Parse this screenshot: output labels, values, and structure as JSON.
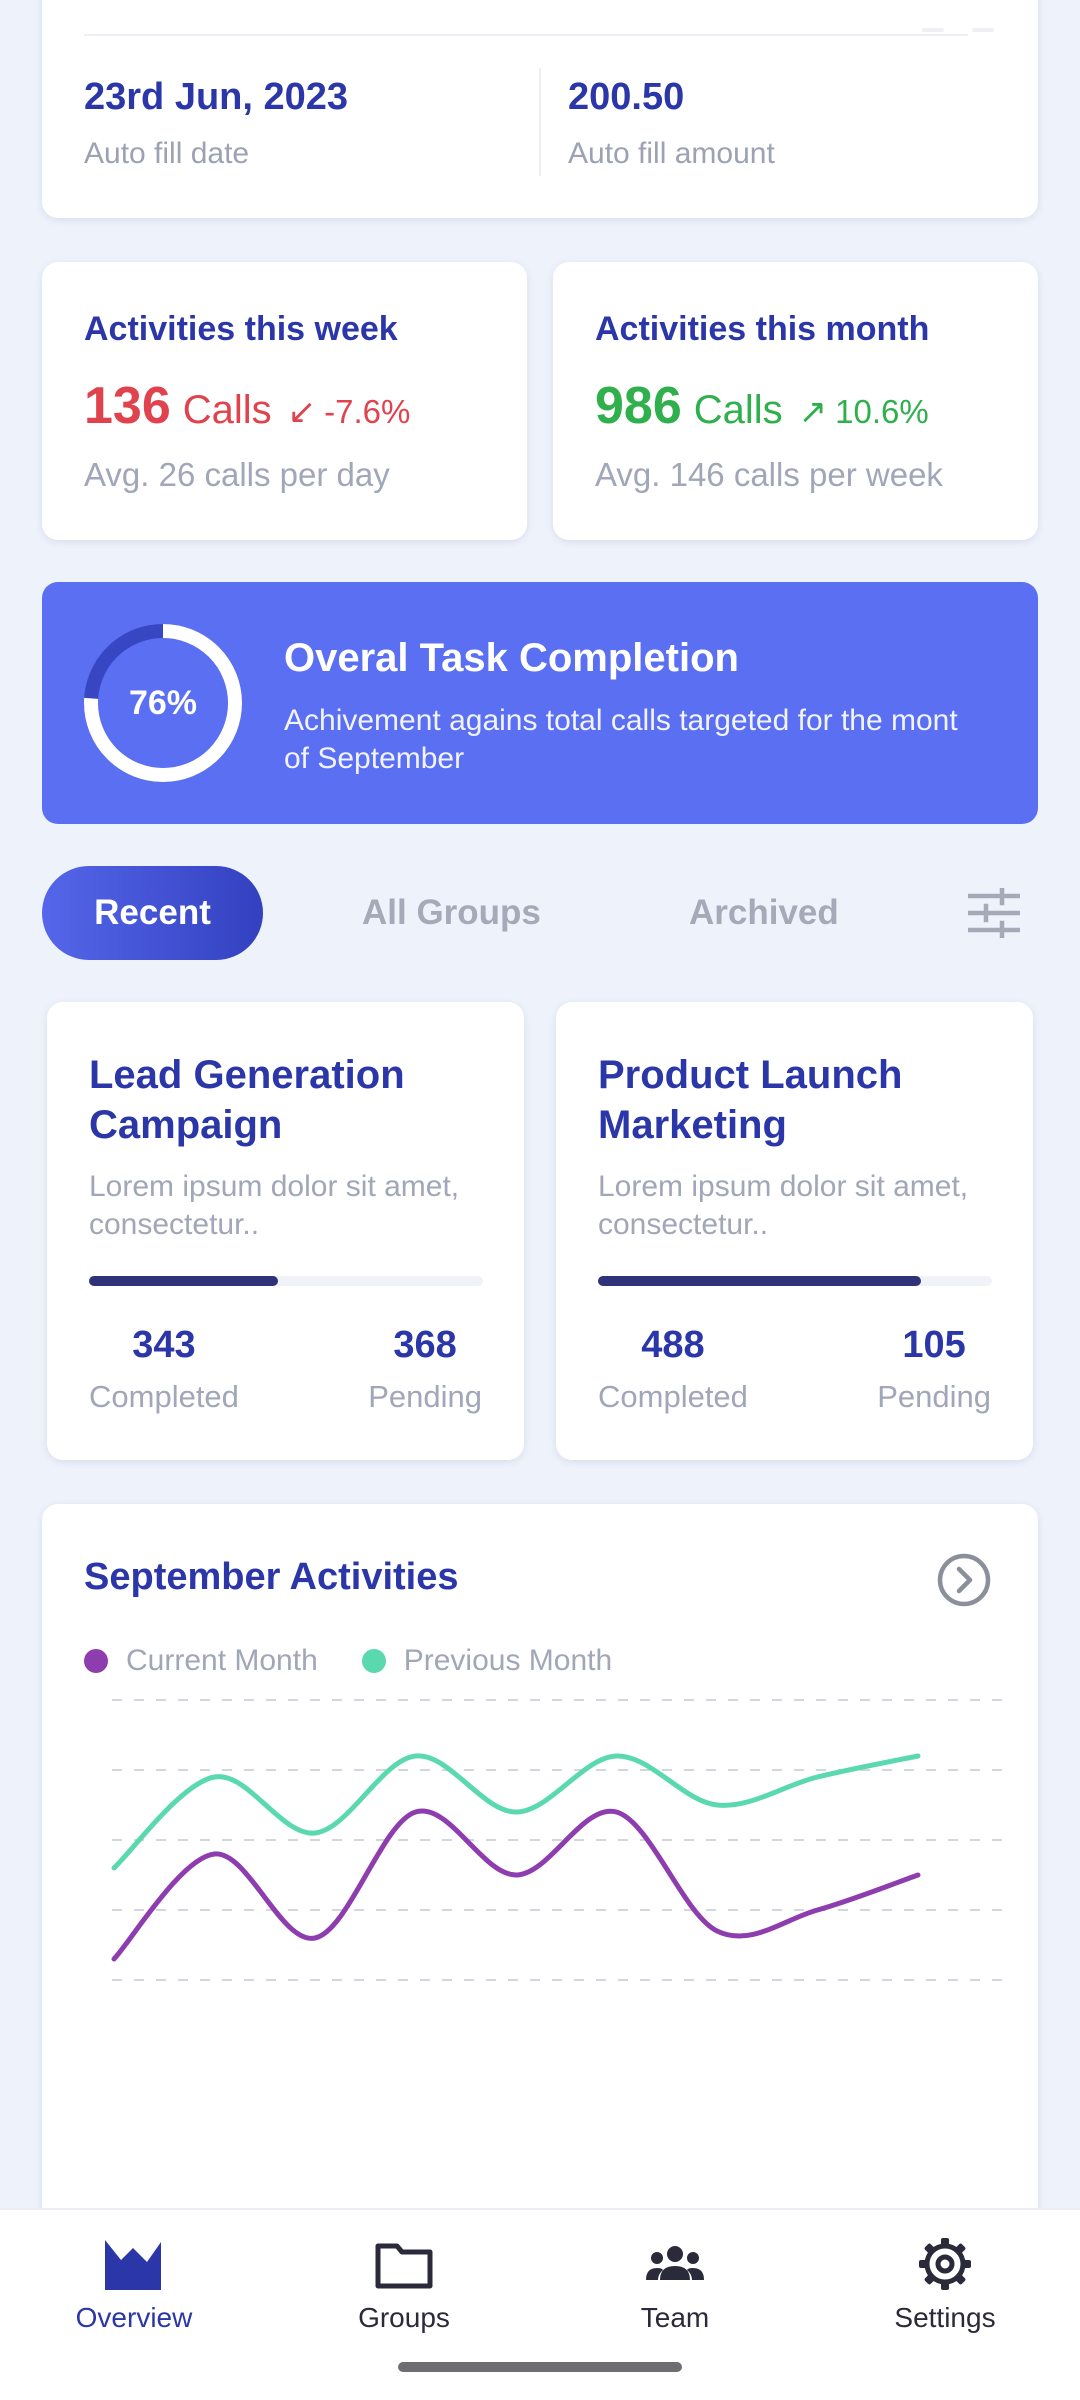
{
  "summary": {
    "date_value": "23rd Jun, 2023",
    "date_label": "Auto fill date",
    "amount_value": "200.50",
    "amount_label": "Auto fill amount"
  },
  "activities": {
    "week": {
      "title": "Activities this week",
      "count": "136",
      "unit": "Calls",
      "trend_arrow": "↙",
      "change": "-7.6%",
      "sub": "Avg. 26 calls per day",
      "trend_color": "#E0434E"
    },
    "month": {
      "title": "Activities this month",
      "count": "986",
      "unit": "Calls",
      "trend_arrow": "↗",
      "change": "10.6%",
      "sub": "Avg. 146 calls per week",
      "trend_color": "#2FB04D"
    }
  },
  "completion": {
    "percent_label": "76%",
    "progress": 0.76,
    "title": "Overal Task Completion",
    "description": "Achivement agains total calls targeted for the mont of September"
  },
  "tabs": {
    "recent": "Recent",
    "all_groups": "All Groups",
    "archived": "Archived",
    "filter_icon": "sliders-icon"
  },
  "groups": [
    {
      "title": "Lead Generation Campaign",
      "description": "Lorem ipsum dolor sit amet, consectetur..",
      "completed": "343",
      "completed_label": "Completed",
      "pending": "368",
      "pending_label": "Pending",
      "progress": 0.48
    },
    {
      "title": "Product Launch Marketing",
      "description": "Lorem ipsum dolor sit amet, consectetur..",
      "completed": "488",
      "completed_label": "Completed",
      "pending": "105",
      "pending_label": "Pending",
      "progress": 0.82
    }
  ],
  "activity_chart": {
    "title": "September Activities",
    "next_icon": "chevron-right-circle-icon",
    "legend_current": "Current Month",
    "legend_previous": "Previous Month",
    "colors": {
      "current": "#8E3DAF",
      "previous": "#5BD9AE",
      "grid": "#D3D6DE"
    }
  },
  "chart_data": {
    "type": "line",
    "x": [
      0,
      1,
      2,
      3,
      4,
      5,
      6,
      7,
      8
    ],
    "series": [
      {
        "name": "Current Month",
        "values": [
          0.3,
          1.8,
          0.6,
          2.4,
          1.5,
          2.4,
          0.7,
          1.0,
          1.5
        ]
      },
      {
        "name": "Previous Month",
        "values": [
          1.6,
          2.9,
          2.1,
          3.2,
          2.4,
          3.2,
          2.5,
          2.9,
          3.2
        ]
      }
    ],
    "ylim": [
      0,
      4
    ],
    "grid": true,
    "legend": "top-left"
  },
  "nav": {
    "overview": "Overview",
    "groups": "Groups",
    "team": "Team",
    "settings": "Settings",
    "active": "Overview"
  }
}
